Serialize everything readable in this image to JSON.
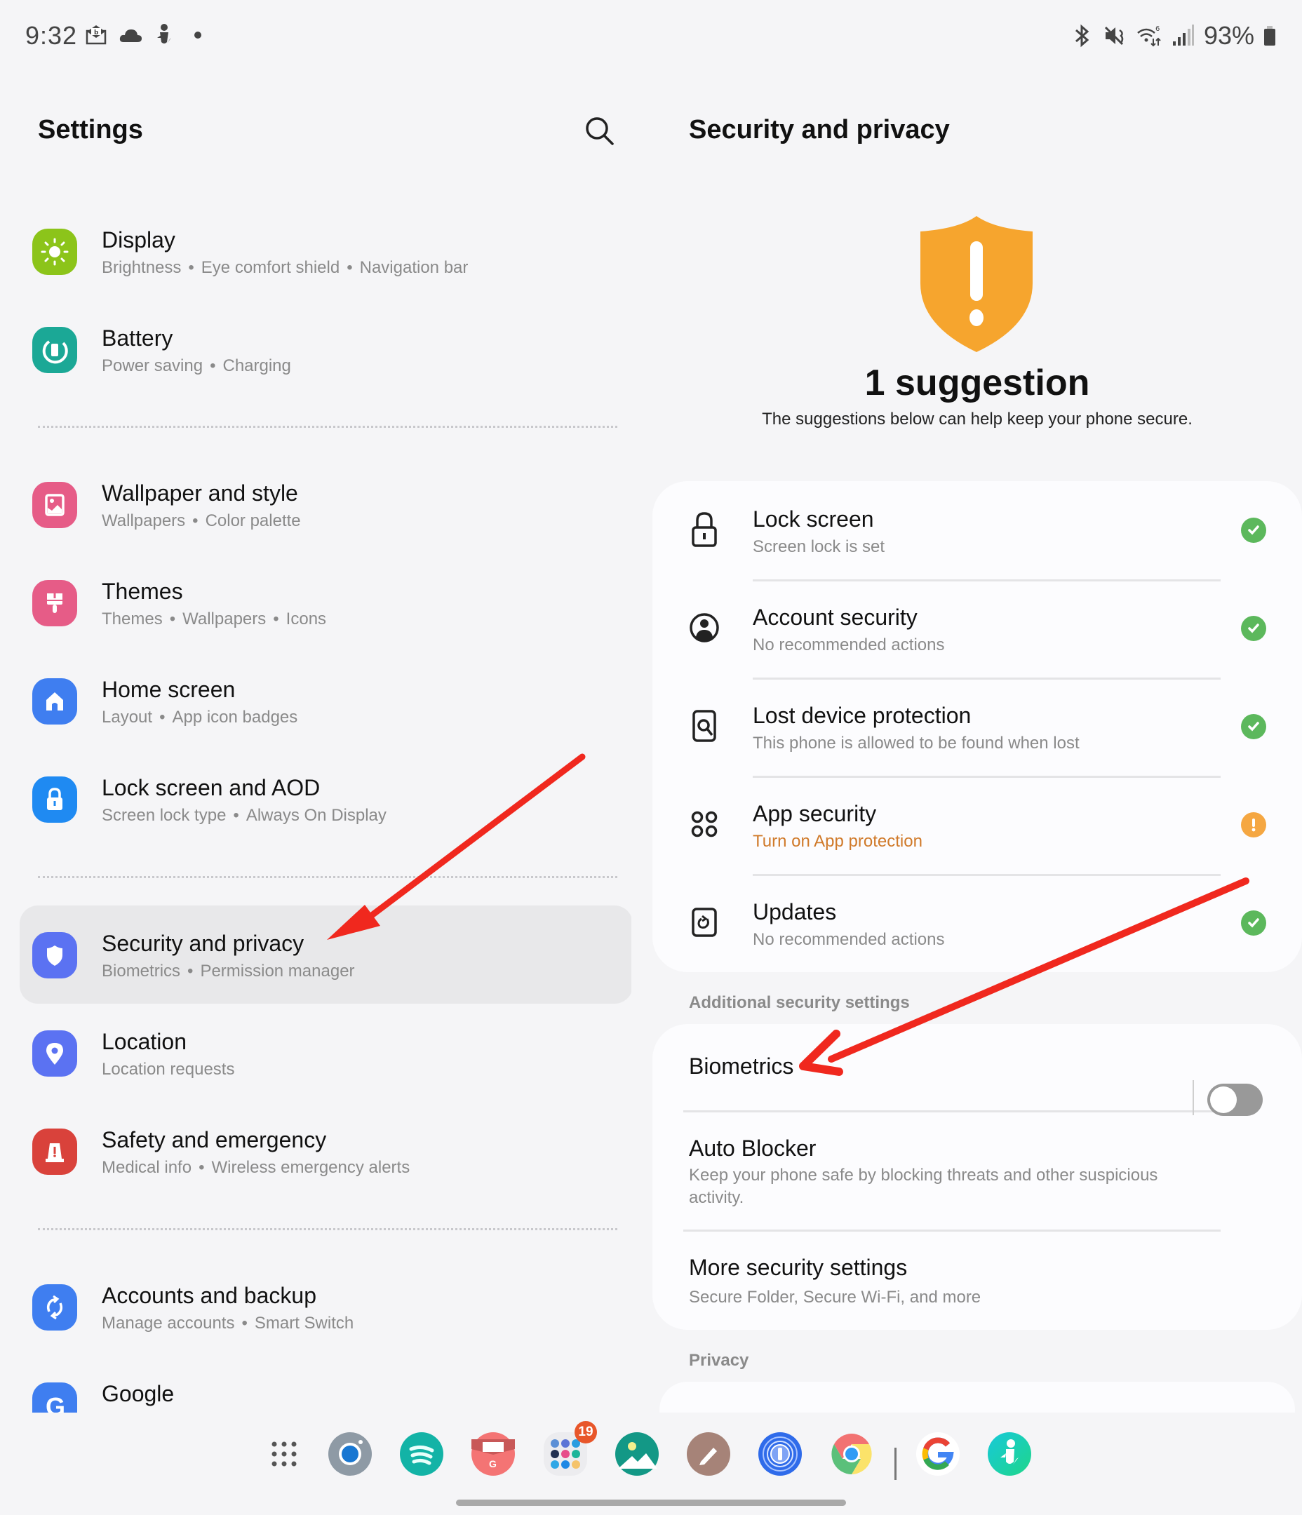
{
  "status_bar": {
    "time": "9:32",
    "left_icons": [
      "mail-notification-icon",
      "cloud-icon",
      "samsung-health-icon",
      "more-notifications-dot"
    ],
    "right_icons": [
      "bluetooth-icon",
      "mute-icon",
      "wifi-6-icon",
      "signal-icon"
    ],
    "battery_percent": "93%"
  },
  "left_pane": {
    "title": "Settings",
    "search_icon": "search-icon",
    "items": [
      {
        "id": "display",
        "title": "Display",
        "subtitle": [
          "Brightness",
          "Eye comfort shield",
          "Navigation bar"
        ],
        "icon": "sun-icon",
        "color": "#8cc41a"
      },
      {
        "id": "battery",
        "title": "Battery",
        "subtitle": [
          "Power saving",
          "Charging"
        ],
        "icon": "battery-icon",
        "color": "#1ba896"
      },
      {
        "id": "wallpaper",
        "title": "Wallpaper and style",
        "subtitle": [
          "Wallpapers",
          "Color palette"
        ],
        "icon": "image-icon",
        "color": "#e65c87"
      },
      {
        "id": "themes",
        "title": "Themes",
        "subtitle": [
          "Themes",
          "Wallpapers",
          "Icons"
        ],
        "icon": "brush-icon",
        "color": "#e65c87"
      },
      {
        "id": "home-screen",
        "title": "Home screen",
        "subtitle": [
          "Layout",
          "App icon badges"
        ],
        "icon": "home-icon",
        "color": "#3f7ef0"
      },
      {
        "id": "lock-screen-aod",
        "title": "Lock screen and AOD",
        "subtitle": [
          "Screen lock type",
          "Always On Display"
        ],
        "icon": "lock-icon",
        "color": "#1f8af2"
      },
      {
        "id": "security-privacy",
        "title": "Security and privacy",
        "subtitle": [
          "Biometrics",
          "Permission manager"
        ],
        "icon": "shield-icon",
        "color": "#5b72f2",
        "selected": true
      },
      {
        "id": "location",
        "title": "Location",
        "subtitle": [
          "Location requests"
        ],
        "icon": "location-pin-icon",
        "color": "#5b72f2"
      },
      {
        "id": "safety-emergency",
        "title": "Safety and emergency",
        "subtitle": [
          "Medical info",
          "Wireless emergency alerts"
        ],
        "icon": "siren-icon",
        "color": "#d9423b"
      },
      {
        "id": "accounts-backup",
        "title": "Accounts and backup",
        "subtitle": [
          "Manage accounts",
          "Smart Switch"
        ],
        "icon": "sync-icon",
        "color": "#3f7ef0"
      },
      {
        "id": "google",
        "title": "Google",
        "subtitle": [],
        "icon": "google-g-icon",
        "color": "#3f7ef0"
      }
    ]
  },
  "right_pane": {
    "title": "Security and privacy",
    "hero": {
      "icon": "shield-warning-icon",
      "count_text": "1 suggestion",
      "description": "The suggestions below can help keep your phone secure."
    },
    "checks": [
      {
        "title": "Lock screen",
        "subtitle": "Screen lock is set",
        "icon": "padlock-icon",
        "status": "ok"
      },
      {
        "title": "Account security",
        "subtitle": "No recommended actions",
        "icon": "account-circle-icon",
        "status": "ok"
      },
      {
        "title": "Lost device protection",
        "subtitle": "This phone is allowed to be found when lost",
        "icon": "find-device-icon",
        "status": "ok"
      },
      {
        "title": "App security",
        "subtitle": "Turn on App protection",
        "icon": "apps-grid-icon",
        "status": "warning"
      },
      {
        "title": "Updates",
        "subtitle": "No recommended actions",
        "icon": "update-icon",
        "status": "ok"
      }
    ],
    "additional_label": "Additional security settings",
    "additional": {
      "biometrics": {
        "title": "Biometrics"
      },
      "auto_blocker": {
        "title": "Auto Blocker",
        "subtitle": "Keep your phone safe by blocking threats and other suspicious activity.",
        "enabled": false
      },
      "more_security": {
        "title": "More security settings",
        "subtitle": "Secure Folder, Secure Wi-Fi, and more"
      }
    },
    "privacy_label": "Privacy"
  },
  "colors": {
    "ok": "#5cb85c",
    "warning": "#f5a742",
    "warning_text": "#d07a2a",
    "annotation_arrow": "#f0281e",
    "hero_shield": "#f6a52e"
  },
  "dock": {
    "apps": [
      {
        "name": "app-drawer",
        "icon": "grid-dots-icon"
      },
      {
        "name": "camera",
        "icon": "camera-icon"
      },
      {
        "name": "spotify",
        "icon": "spotify-icon"
      },
      {
        "name": "gmail",
        "icon": "mail-g-icon"
      },
      {
        "name": "app-folder",
        "icon": "folder-icon",
        "badge": "19"
      },
      {
        "name": "gallery",
        "icon": "gallery-icon"
      },
      {
        "name": "notes",
        "icon": "pencil-icon"
      },
      {
        "name": "1password",
        "icon": "keyhole-icon"
      },
      {
        "name": "chrome",
        "icon": "chrome-icon"
      },
      {
        "name": "google",
        "icon": "google-icon"
      },
      {
        "name": "samsung-health",
        "icon": "health-icon"
      }
    ]
  }
}
